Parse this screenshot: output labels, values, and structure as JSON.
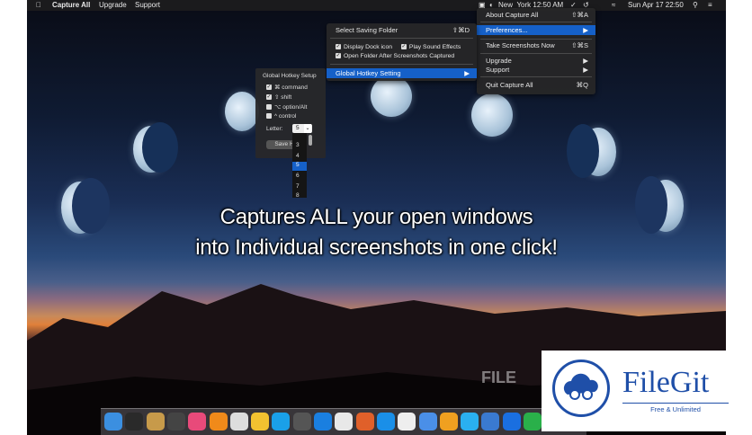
{
  "menubar": {
    "app_name": "Capture All",
    "upgrade": "Upgrade",
    "support": "Support",
    "location_time": "New_York 12:50 AM",
    "datetime": "Sun Apr 17  22:50"
  },
  "app_menu": {
    "about": "About Capture All",
    "about_shortcut": "⇧⌘A",
    "preferences": "Preferences...",
    "take_screenshots": "Take Screenshots Now",
    "take_shortcut": "⇧⌘S",
    "upgrade": "Upgrade",
    "support": "Support",
    "quit": "Quit Capture All",
    "quit_shortcut": "⌘Q"
  },
  "prefs_menu": {
    "select_folder": "Select Saving Folder",
    "select_folder_shortcut": "⇧⌘D",
    "display_dock_icon": "Display Dock icon",
    "play_sound": "Play Sound Effects",
    "open_folder": "Open Folder After Screenshots Captured",
    "global_hotkey": "Global Hotkey Setting"
  },
  "hotkey_panel": {
    "title": "Global Hotkey Setup",
    "command": "⌘ command",
    "shift": "⇧ shift",
    "option": "⌥ option/Alt",
    "control": "^ control",
    "letter_label": "Letter:",
    "letter_value": "5",
    "save_button": "Save H",
    "options": [
      "3",
      "4",
      "5",
      "6",
      "7",
      "8"
    ]
  },
  "caption": {
    "line1": "Captures ALL your open windows",
    "line2": "into Individual screenshots in one click!"
  },
  "watermark": {
    "text": "FILE"
  },
  "filegit": {
    "title": "FileGit",
    "subtitle": "Free & Unlimited"
  },
  "dock_icons": [
    "finder-icon",
    "launchpad-icon",
    "photos-icon",
    "time-machine-icon",
    "itunes-icon",
    "ibooks-icon",
    "reminders-icon",
    "photos-flower-icon",
    "skype-icon",
    "activity-monitor-icon",
    "safari-icon",
    "chrome-icon",
    "firefox-icon",
    "app-store-icon",
    "textedit-icon",
    "xcode-icon",
    "pages-icon",
    "messages-icon",
    "hex-icon",
    "quicktime-icon",
    "facetime-icon",
    "folder-icon",
    "trash-icon"
  ]
}
